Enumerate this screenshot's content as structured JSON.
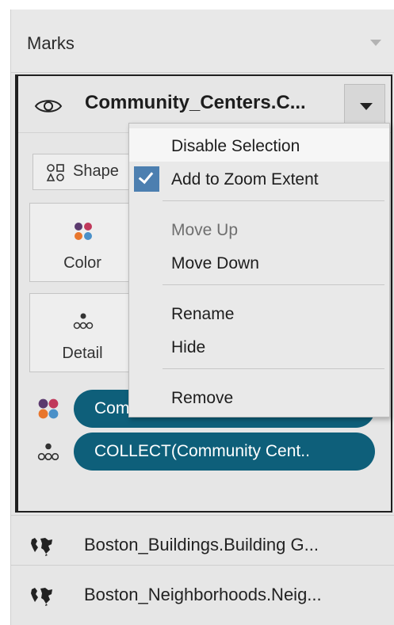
{
  "marks": {
    "title": "Marks"
  },
  "active_layer": {
    "name": "Community_Centers.C...",
    "icons": {
      "visibility": "eye-icon",
      "dropdown": "caret-down-icon"
    },
    "buttons": {
      "shape": "Shape",
      "color": "Color",
      "detail": "Detail"
    },
    "pills": [
      {
        "icon": "color-dots-icon",
        "label": "Com"
      },
      {
        "icon": "detail-dots-icon",
        "label": "COLLECT(Community Cent.."
      }
    ]
  },
  "context_menu": {
    "items": [
      {
        "label": "Disable Selection",
        "state": "hover"
      },
      {
        "label": "Add to Zoom Extent",
        "checked": true
      },
      {
        "label": "Move Up",
        "disabled": true
      },
      {
        "label": "Move Down"
      },
      {
        "label": "Rename"
      },
      {
        "label": "Hide"
      },
      {
        "label": "Remove"
      }
    ]
  },
  "other_layers": [
    {
      "icon": "map-icon",
      "label": "Boston_Buildings.Building G..."
    },
    {
      "icon": "map-icon",
      "label": "Boston_Neighborhoods.Neig..."
    }
  ],
  "colors": {
    "pill_background": "#0e5f7a",
    "check_accent": "#4c7fb0",
    "color_dot_1": "#5b3a6e",
    "color_dot_2": "#c0395b",
    "color_dot_3": "#e8762d",
    "color_dot_4": "#4a90c8"
  }
}
